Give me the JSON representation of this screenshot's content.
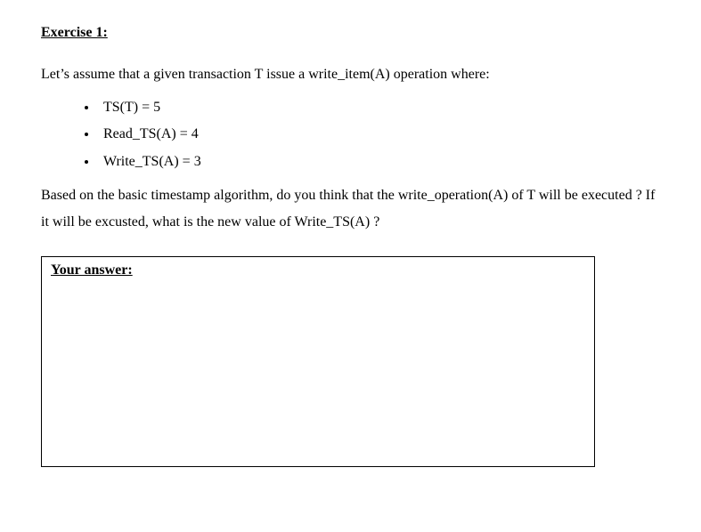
{
  "heading": "Exercise 1:",
  "intro": "Let’s assume that a given transaction T issue a write_item(A) operation where:",
  "bullets": [
    "TS(T) = 5",
    "Read_TS(A) = 4",
    "Write_TS(A) = 3"
  ],
  "question": "Based on the basic timestamp algorithm, do you think that the write_operation(A) of T will be executed ? If it will be excusted, what is the new value of Write_TS(A) ?",
  "answer_label": "Your answer:"
}
